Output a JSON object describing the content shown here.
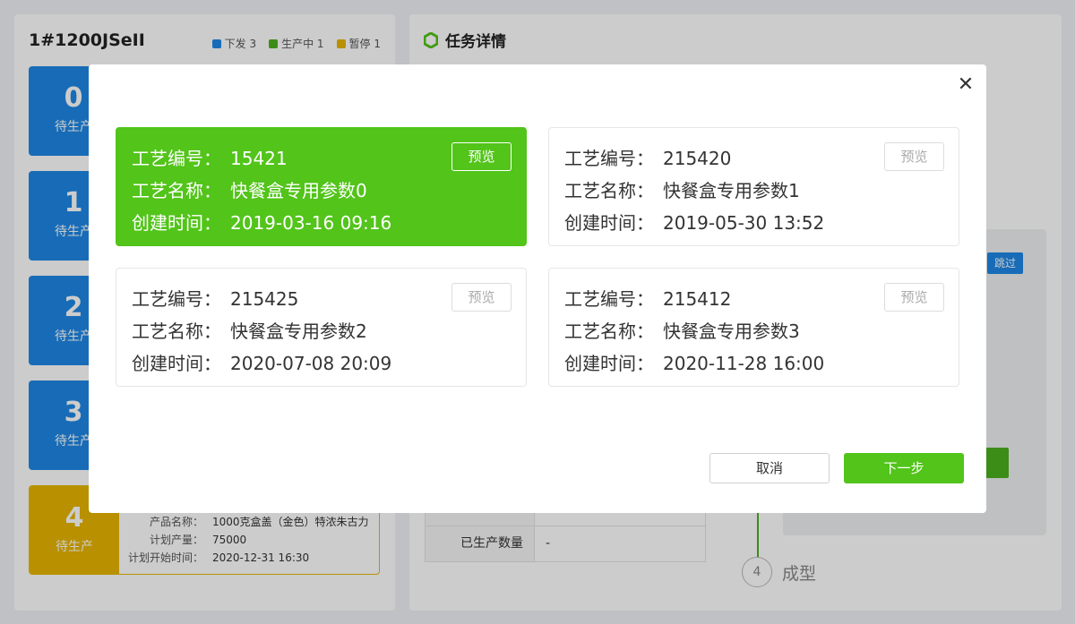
{
  "background": {
    "machine_title": "1#1200JSeII",
    "legend": [
      {
        "label": "下发 3",
        "color": "#1e88e5"
      },
      {
        "label": "生产中 1",
        "color": "#4caf1e"
      },
      {
        "label": "暂停 1",
        "color": "#e6b400"
      }
    ],
    "tasks": [
      {
        "num": "0",
        "status": "待生产"
      },
      {
        "num": "1",
        "status": "待生产"
      },
      {
        "num": "2",
        "status": "待生产"
      },
      {
        "num": "3",
        "status": "待生产"
      },
      {
        "num": "4",
        "status": "待生产"
      }
    ],
    "task4_info": {
      "product_label": "产品名称：",
      "product_value": "1000克盒盖（金色）特浓朱古力",
      "qty_label": "计划产量：",
      "qty_value": "75000",
      "start_label": "计划开始时间：",
      "start_value": "2020-12-31 16:30"
    },
    "detail_title": "任务详情",
    "skip_label": "跳过",
    "produced_label": "已生产数量",
    "produced_value": "-",
    "step_number": "4",
    "step_label": "成型"
  },
  "modal": {
    "options": [
      {
        "code_label": "工艺编号：",
        "code": "15421",
        "name_label": "工艺名称：",
        "name": "快餐盒专用参数0",
        "time_label": "创建时间：",
        "time": "2019-03-16 09:16",
        "preview": "预览"
      },
      {
        "code_label": "工艺编号：",
        "code": "215420",
        "name_label": "工艺名称：",
        "name": "快餐盒专用参数1",
        "time_label": "创建时间：",
        "time": "2019-05-30 13:52",
        "preview": "预览"
      },
      {
        "code_label": "工艺编号：",
        "code": "215425",
        "name_label": "工艺名称：",
        "name": "快餐盒专用参数2",
        "time_label": "创建时间：",
        "time": "2020-07-08 20:09",
        "preview": "预览"
      },
      {
        "code_label": "工艺编号：",
        "code": "215412",
        "name_label": "工艺名称：",
        "name": "快餐盒专用参数3",
        "time_label": "创建时间：",
        "time": "2020-11-28 16:00",
        "preview": "预览"
      }
    ],
    "cancel": "取消",
    "next": "下一步",
    "selected_color": "#52c41a"
  }
}
